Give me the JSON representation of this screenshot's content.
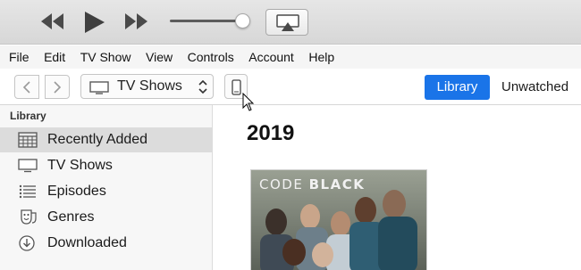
{
  "player": {
    "controls": [
      "rewind-icon",
      "play-icon",
      "fast-forward-icon",
      "airplay-icon"
    ],
    "volume_level": 0.9
  },
  "menubar": {
    "items": [
      "File",
      "Edit",
      "TV Show",
      "View",
      "Controls",
      "Account",
      "Help"
    ]
  },
  "toolbar": {
    "media_kind": "TV Shows",
    "tabs": [
      "Library",
      "Unwatched"
    ],
    "active_tab": "Library",
    "accent_color": "#1a74e8"
  },
  "sidebar": {
    "heading": "Library",
    "items": [
      {
        "label": "Recently Added",
        "icon": "grid-icon",
        "selected": true
      },
      {
        "label": "TV Shows",
        "icon": "tv-icon",
        "selected": false
      },
      {
        "label": "Episodes",
        "icon": "list-icon",
        "selected": false
      },
      {
        "label": "Genres",
        "icon": "masks-icon",
        "selected": false
      },
      {
        "label": "Downloaded",
        "icon": "download-icon",
        "selected": false
      }
    ]
  },
  "content": {
    "section_title": "2019",
    "poster": {
      "title_light": "CODE",
      "title_bold": "BLACK"
    }
  }
}
